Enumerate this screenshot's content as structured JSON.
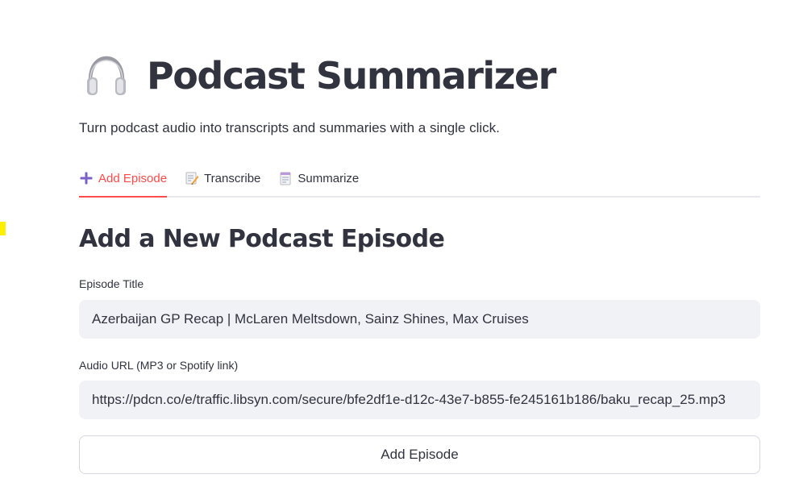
{
  "header": {
    "icon": "headphones-icon",
    "title": "Podcast Summarizer",
    "subtitle": "Turn podcast audio into transcripts and summaries with a single click."
  },
  "tabs": [
    {
      "label": "Add Episode",
      "icon": "plus-icon",
      "active": true
    },
    {
      "label": "Transcribe",
      "icon": "memo-icon",
      "active": false
    },
    {
      "label": "Summarize",
      "icon": "notepad-icon",
      "active": false
    }
  ],
  "form": {
    "heading": "Add a New Podcast Episode",
    "episode_title_label": "Episode Title",
    "episode_title_value": "Azerbaijan GP Recap | McLaren Meltsdown, Sainz Shines, Max Cruises",
    "audio_url_label": "Audio URL (MP3 or Spotify link)",
    "audio_url_value": "https://pdcn.co/e/traffic.libsyn.com/secure/bfe2df1e-d12c-43e7-b855-fe245161b186/baku_recap_25.mp3",
    "submit_label": "Add Episode"
  },
  "colors": {
    "accent": "#ff4b4b",
    "input_bg": "#f0f2f6",
    "text": "#31333f",
    "plus_icon": "#7b61c7"
  }
}
